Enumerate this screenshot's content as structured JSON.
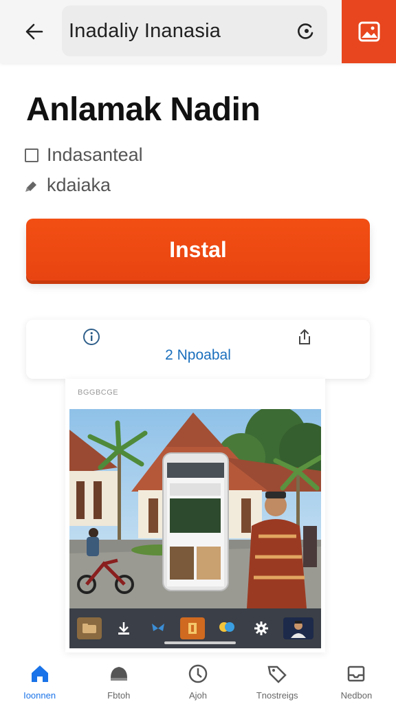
{
  "header": {
    "search_text": "Inadaliy Inanasia"
  },
  "app": {
    "title": "Anlamak Nadin",
    "meta_1": "Indasanteal",
    "meta_2": "kdaiaka"
  },
  "install": {
    "label": "Instal"
  },
  "info_card": {
    "link_text": "2 Npoabal"
  },
  "screenshot": {
    "caption": "BGGBCGE"
  },
  "bottom_nav": {
    "items": [
      {
        "label": "Ioonnen",
        "icon": "home-icon",
        "active": true
      },
      {
        "label": "Fbtoh",
        "icon": "games-icon",
        "active": false
      },
      {
        "label": "Ajoh",
        "icon": "apps-icon",
        "active": false
      },
      {
        "label": "Tnostreigs",
        "icon": "offers-icon",
        "active": false
      },
      {
        "label": "Nedbon",
        "icon": "books-icon",
        "active": false
      }
    ]
  },
  "colors": {
    "accent": "#e8461e",
    "link": "#1a6fbd",
    "nav_active": "#1a73e8"
  }
}
